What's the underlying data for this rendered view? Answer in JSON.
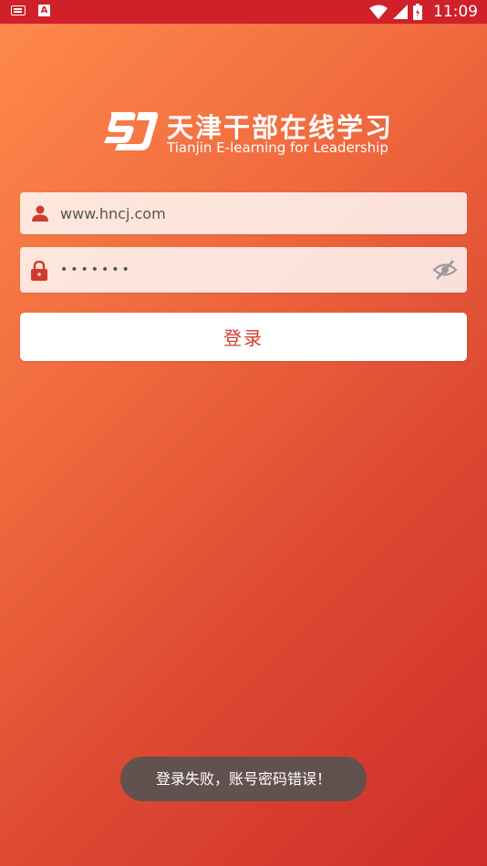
{
  "status_bar": {
    "time": "11:09",
    "left_icons": [
      "keyboard-icon",
      "a-notification-icon"
    ],
    "right_icons": [
      "wifi-icon",
      "signal-icon",
      "battery-icon"
    ]
  },
  "logo": {
    "title_cn": "天津干部在线学习",
    "subtitle_en": "Tianjin E-learning for Leadership"
  },
  "form": {
    "username_value": "www.hncj.com",
    "password_value": "•••••••",
    "username_icon": "person-icon",
    "password_icon": "lock-icon",
    "visibility_icon": "eye-off-icon"
  },
  "login_button": {
    "label": "登录"
  },
  "toast": {
    "message": "登录失败，账号密码错误！"
  },
  "colors": {
    "statusbar": "#d0202a",
    "gradient_start": "#ff8a4c",
    "gradient_end": "#cf2d29",
    "accent": "#d43a2c",
    "toast_bg": "#585250"
  }
}
